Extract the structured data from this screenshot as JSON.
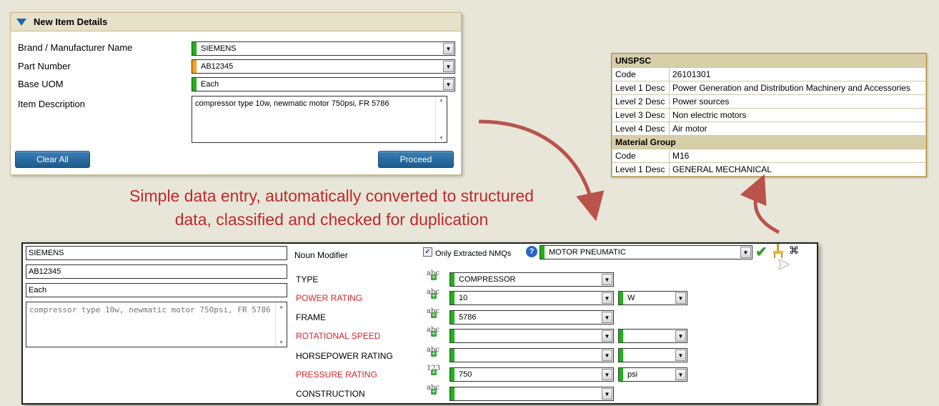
{
  "new_item": {
    "title": "New Item Details",
    "brand_label": "Brand / Manufacturer Name",
    "brand_value": "SIEMENS",
    "part_label": "Part Number",
    "part_value": "AB12345",
    "uom_label": "Base UOM",
    "uom_value": "Each",
    "desc_label": "Item Description",
    "desc_value": "compressor type 10w, newmatic motor 750psi, FR 5786",
    "clear_label": "Clear All",
    "proceed_label": "Proceed",
    "colors": {
      "ok": "#21b21b",
      "warn": "#f5a21b"
    }
  },
  "unspsc": {
    "header": "UNSPSC",
    "rows": [
      {
        "k": "Code",
        "v": "26101301"
      },
      {
        "k": "Level 1 Desc",
        "v": "Power Generation and Distribution Machinery and Accessories"
      },
      {
        "k": "Level 2 Desc",
        "v": "Power sources"
      },
      {
        "k": "Level 3 Desc",
        "v": "Non electric motors"
      },
      {
        "k": "Level 4 Desc",
        "v": "Air motor"
      }
    ],
    "material_header": "Material Group",
    "material_rows": [
      {
        "k": "Code",
        "v": "M16"
      },
      {
        "k": "Level 1 Desc",
        "v": "GENERAL MECHANICAL"
      }
    ]
  },
  "caption": {
    "line1": "Simple data entry, automatically converted to structured",
    "line2": "data, classified and checked for duplication"
  },
  "structured": {
    "brand": "SIEMENS",
    "part": "AB12345",
    "uom": "Each",
    "desc": "compressor type 10w, newmatic motor 750psi, FR 5786",
    "noun_modifier_label": "Noun Modifier",
    "only_extracted_label": "Only Extracted NMQs",
    "noun_modifier_value": "MOTOR PNEUMATIC",
    "attributes": [
      {
        "name": "TYPE",
        "required": false,
        "type_icon": "abc",
        "value": "COMPRESSOR",
        "unit": null
      },
      {
        "name": "POWER RATING",
        "required": true,
        "type_icon": "abc",
        "value": "10",
        "unit": "W"
      },
      {
        "name": "FRAME",
        "required": false,
        "type_icon": "abc",
        "value": "5786",
        "unit": null
      },
      {
        "name": "ROTATIONAL SPEED",
        "required": true,
        "type_icon": "abc",
        "value": "",
        "unit": ""
      },
      {
        "name": "HORSEPOWER RATING",
        "required": false,
        "type_icon": "abc",
        "value": "",
        "unit": ""
      },
      {
        "name": "PRESSURE RATING",
        "required": true,
        "type_icon": "123",
        "value": "750",
        "unit": "psi"
      },
      {
        "name": "CONSTRUCTION",
        "required": false,
        "type_icon": "abc",
        "value": "",
        "unit": null
      }
    ]
  },
  "icons": [
    "chevron-down-icon",
    "help-icon",
    "checkmark-icon",
    "broom-icon",
    "cursor-icon",
    "binoculars-icon",
    "triangle-down-icon"
  ]
}
